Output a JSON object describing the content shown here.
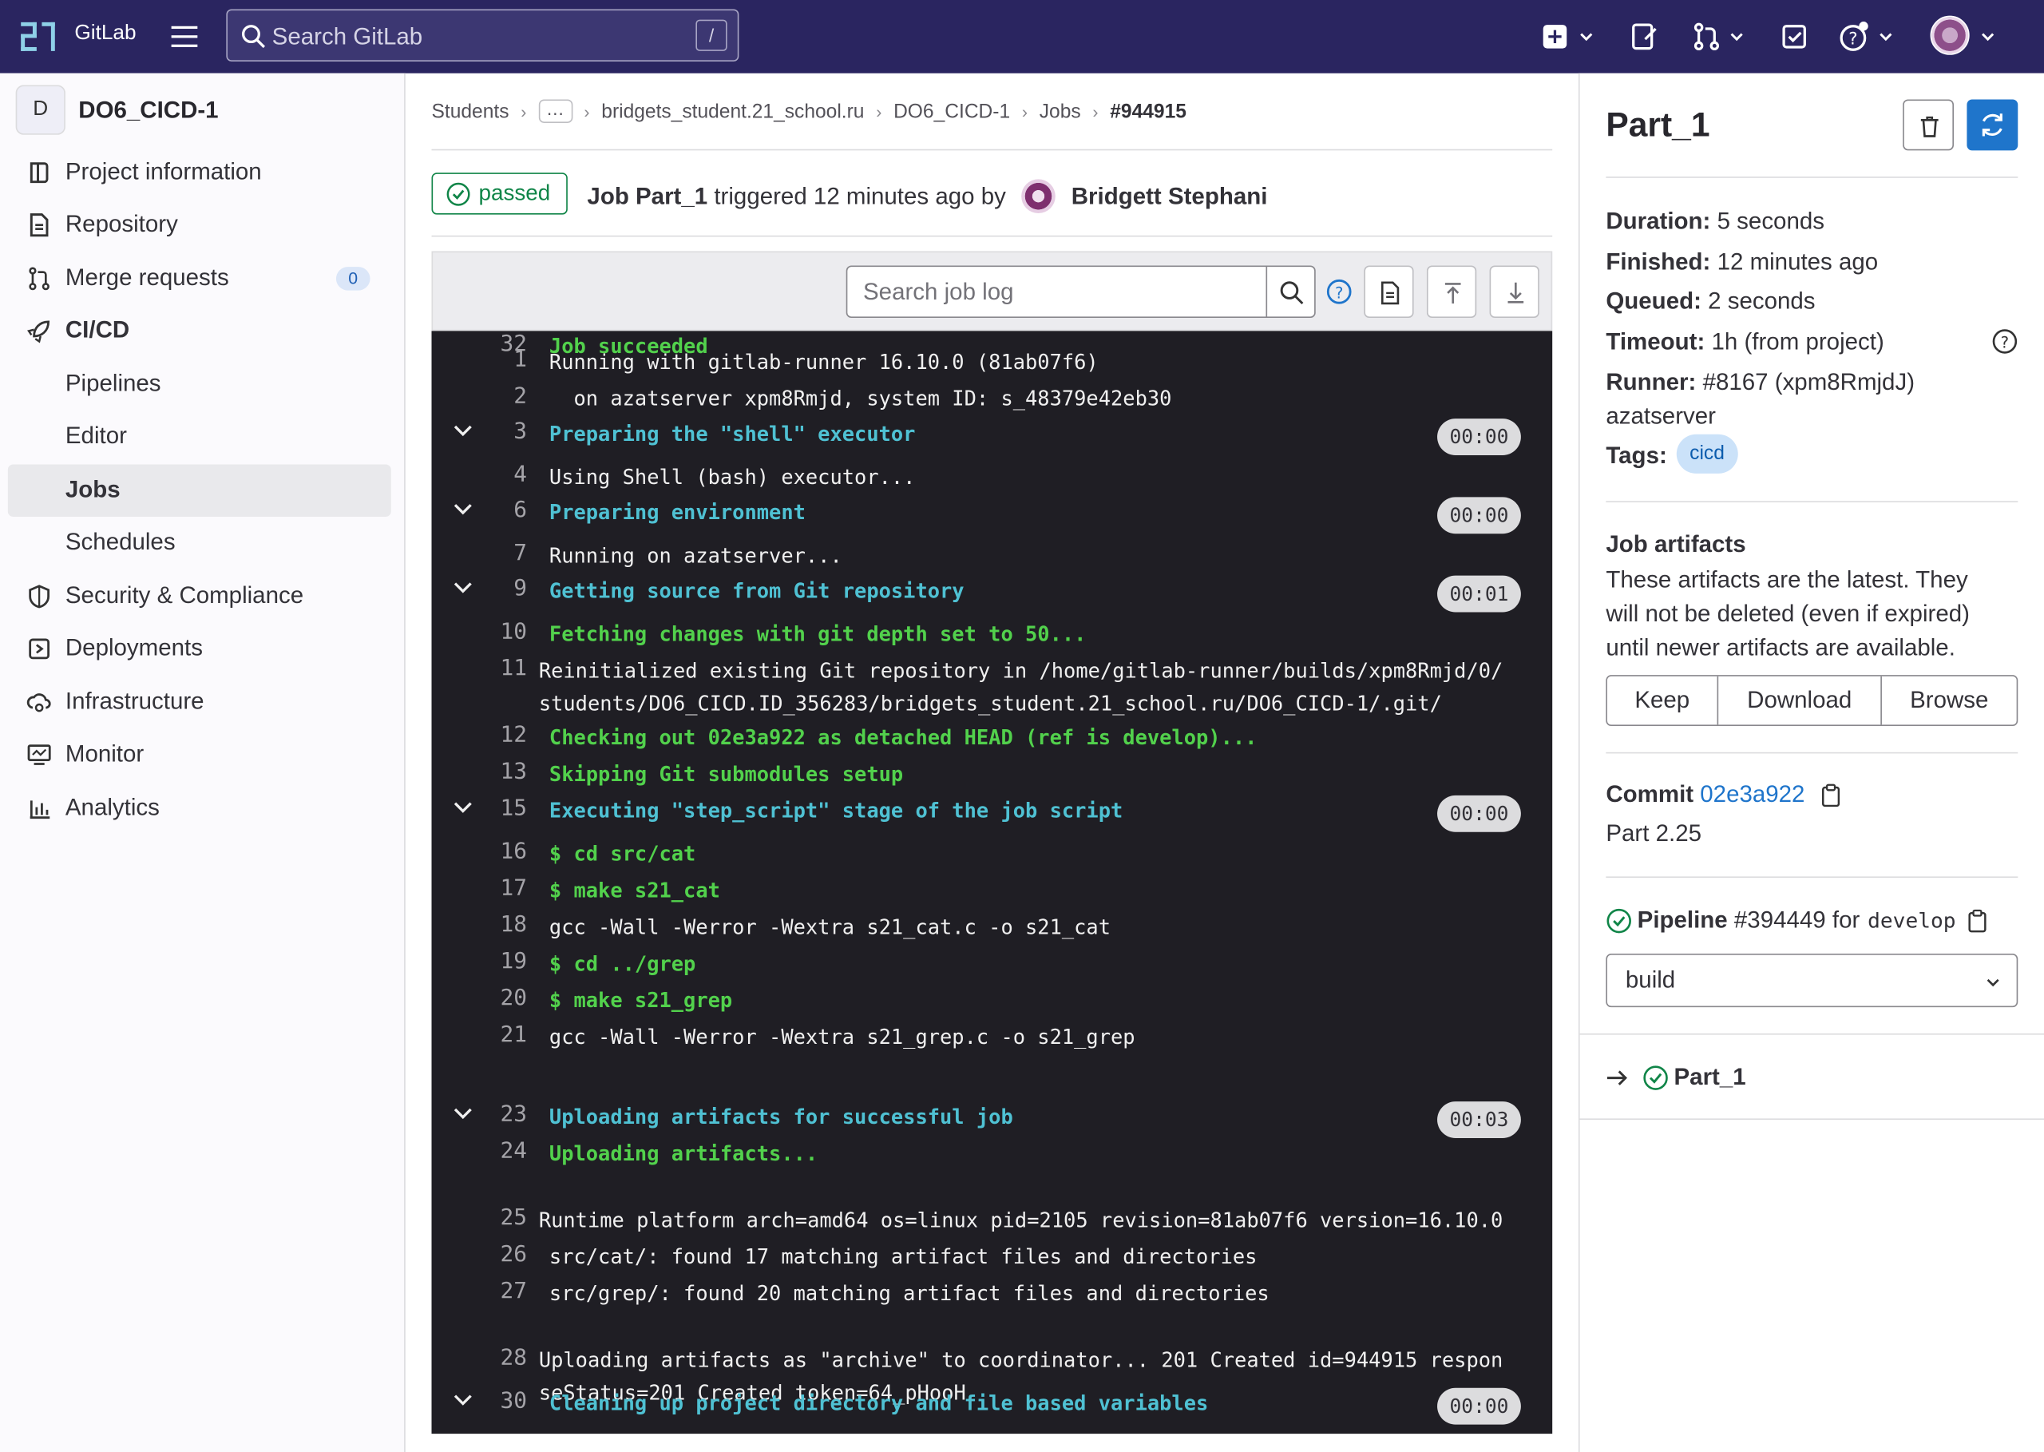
{
  "app": {
    "brand": "GitLab"
  },
  "search": {
    "placeholder": "Search GitLab",
    "shortcut": "/"
  },
  "sidebar": {
    "project_initial": "D",
    "project_name": "DO6_CICD-1",
    "items": [
      {
        "label": "Project information",
        "icon": "project-info-icon"
      },
      {
        "label": "Repository",
        "icon": "doc-icon"
      },
      {
        "label": "Merge requests",
        "icon": "merge-request-icon",
        "badge": "0"
      },
      {
        "label": "CI/CD",
        "icon": "rocket-icon"
      },
      {
        "label": "Pipelines"
      },
      {
        "label": "Editor"
      },
      {
        "label": "Jobs"
      },
      {
        "label": "Schedules"
      },
      {
        "label": "Security & Compliance",
        "icon": "shield-icon"
      },
      {
        "label": "Deployments",
        "icon": "deployments-icon"
      },
      {
        "label": "Infrastructure",
        "icon": "cloud-gear-icon"
      },
      {
        "label": "Monitor",
        "icon": "monitor-icon"
      },
      {
        "label": "Analytics",
        "icon": "chart-icon"
      }
    ]
  },
  "breadcrumb": [
    "Students",
    "bridgets_student.21_school.ru",
    "DO6_CICD-1",
    "Jobs",
    "#944915"
  ],
  "job_header": {
    "status": "passed",
    "job_label": "Job Part_1",
    "triggered_text": "triggered 12 minutes ago by",
    "user": "Bridgett Stephani"
  },
  "log_toolbar": {
    "search_placeholder": "Search job log"
  },
  "log": {
    "lines": [
      {
        "n": "1",
        "text": "Running with gitlab-runner 16.10.0 (81ab07f6)",
        "style": "normal"
      },
      {
        "n": "2",
        "text": "  on azatserver xpm8Rmjd, system ID: s_48379e42eb30",
        "style": "normal"
      },
      {
        "n": "3",
        "text": "Preparing the \"shell\" executor",
        "style": "section",
        "duration": "00:00"
      },
      {
        "n": "4",
        "text": "Using Shell (bash) executor...",
        "style": "normal"
      },
      {
        "n": "6",
        "text": "Preparing environment",
        "style": "section",
        "duration": "00:00"
      },
      {
        "n": "7",
        "text": "Running on azatserver...",
        "style": "normal"
      },
      {
        "n": "9",
        "text": "Getting source from Git repository",
        "style": "section",
        "duration": "00:01"
      },
      {
        "n": "10",
        "text": "Fetching changes with git depth set to 50...",
        "style": "green"
      },
      {
        "n": "11",
        "text": "Reinitialized existing Git repository in /home/gitlab-runner/builds/xpm8Rmjd/0/students/DO6_CICD.ID_356283/bridgets_student.21_school.ru/DO6_CICD-1/.git/",
        "style": "normal"
      },
      {
        "n": "12",
        "text": "Checking out 02e3a922 as detached HEAD (ref is develop)...",
        "style": "green"
      },
      {
        "n": "13",
        "text": "Skipping Git submodules setup",
        "style": "green"
      },
      {
        "n": "15",
        "text": "Executing \"step_script\" stage of the job script",
        "style": "section",
        "duration": "00:00"
      },
      {
        "n": "16",
        "text": "$ cd src/cat",
        "style": "green"
      },
      {
        "n": "17",
        "text": "$ make s21_cat",
        "style": "green"
      },
      {
        "n": "18",
        "text": "gcc -Wall -Werror -Wextra s21_cat.c -o s21_cat",
        "style": "normal"
      },
      {
        "n": "19",
        "text": "$ cd ../grep",
        "style": "green"
      },
      {
        "n": "20",
        "text": "$ make s21_grep",
        "style": "green"
      },
      {
        "n": "21",
        "text": "gcc -Wall -Werror -Wextra s21_grep.c -o s21_grep",
        "style": "normal"
      },
      {
        "n": "23",
        "text": "Uploading artifacts for successful job",
        "style": "section",
        "duration": "00:03"
      },
      {
        "n": "24",
        "text": "Uploading artifacts...",
        "style": "green"
      },
      {
        "n": "25",
        "text": "Runtime platform                                    arch=amd64 os=linux pid=2105 revision=81ab07f6 version=16.10.0",
        "style": "normal"
      },
      {
        "n": "26",
        "text": "src/cat/: found 17 matching artifact files and directories",
        "style": "normal"
      },
      {
        "n": "27",
        "text": "src/grep/: found 20 matching artifact files and directories",
        "style": "normal"
      },
      {
        "n": "28",
        "text": "Uploading artifacts as \"archive\" to coordinator... 201 Created  id=944915 responseStatus=201 Created token=64_pHooH",
        "style": "normal"
      },
      {
        "n": "30",
        "text": "Cleaning up project directory and file based variables",
        "style": "section",
        "duration": "00:00"
      },
      {
        "n": "32",
        "text": "Job succeeded",
        "style": "green"
      }
    ]
  },
  "right_panel": {
    "title": "Part_1",
    "duration_label": "Duration:",
    "duration": "5 seconds",
    "finished_label": "Finished:",
    "finished": "12 minutes ago",
    "queued_label": "Queued:",
    "queued": "2 seconds",
    "timeout_label": "Timeout:",
    "timeout": "1h (from project)",
    "runner_label": "Runner:",
    "runner": "#8167 (xpm8RmjdJ)",
    "runner_name": "azatserver",
    "tags_label": "Tags:",
    "tag": "cicd",
    "artifacts_title": "Job artifacts",
    "artifacts_desc": "These artifacts are the latest. They will not be deleted (even if expired) until newer artifacts are available.",
    "keep": "Keep",
    "download": "Download",
    "browse": "Browse",
    "commit_label": "Commit",
    "commit_sha": "02e3a922",
    "commit_msg": "Part 2.25",
    "pipeline_label": "Pipeline",
    "pipeline_id": "#394449",
    "pipeline_for": "for",
    "pipeline_ref": "develop",
    "stage": "build",
    "job_name": "Part_1"
  },
  "colors": {
    "topbar": "#2a2560",
    "success": "#108548",
    "link": "#1f75cb",
    "log_bg": "#1f1e24",
    "log_section": "#4fc1d3",
    "log_green": "#52d14c"
  }
}
